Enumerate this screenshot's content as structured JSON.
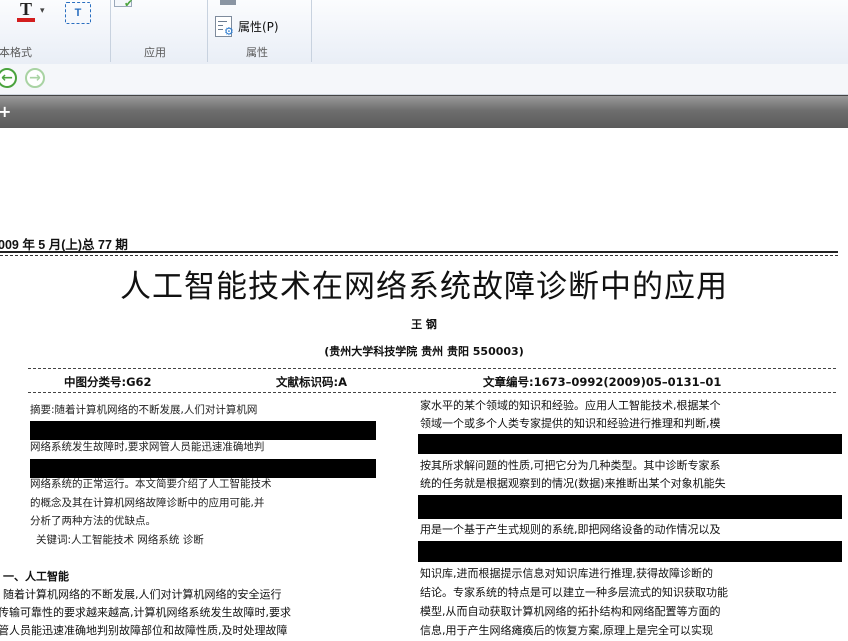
{
  "ribbon": {
    "groups": [
      "本格式",
      "应用",
      "属性"
    ],
    "properties_button": "属性(P)",
    "font_color_icon": "font-color-icon",
    "text_frame_icon": "text-frame-icon",
    "dropdown_arrow": "▾",
    "text_frame_glyph": "T"
  },
  "nav": {
    "back_glyph": "←",
    "forward_glyph": "→"
  },
  "toolbar": {
    "add_glyph": "+"
  },
  "doc": {
    "issue": "009 年 5 月(上)总 77 期",
    "title": "人工智能技术在网络系统故障诊断中的应用",
    "author": "王 钢",
    "affiliation": "(贵州大学科技学院   贵州 贵阳 550003)",
    "meta": {
      "class_no": "中图分类号:G62",
      "doc_code": "文献标识码:A",
      "article_no": "文章编号:1673–0992(2009)05–0131–01"
    },
    "abstract_lines": [
      "摘要:随着计算机网络的不断发展,人们对计算机网",
      "网络系统发生故障时,要求网管人员能迅速准确地判",
      "网络系统的正常运行。本文简要介绍了人工智能技术",
      "的概念及其在计算机网络故障诊断中的应用可能,并",
      "分析了两种方法的优缺点。"
    ],
    "keywords": "关键词:人工智能技术  网络系统  诊断",
    "section1_heading": "一、人工智能",
    "left_body": [
      "随着计算机网络的不断发展,人们对计算机网络的安全运行",
      "传输可靠性的要求越来越高,计算机网络系统发生故障时,要求",
      "管人员能迅速准确地判别故障部位和故障性质,及时处理故障"
    ],
    "right_lines": [
      "家水平的某个领域的知识和经验。应用人工智能技术,根据某个",
      "领域一个或多个人类专家提供的知识和经验进行推理和判断,模",
      "按其所求解问题的性质,可把它分为几种类型。其中诊断专家系",
      "统的任务就是根据观察到的情况(数据)来推断出某个对象机能失",
      "用是一个基于产生式规则的系统,即把网络设备的动作情况以及",
      "知识库,进而根据提示信息对知识库进行推理,获得故障诊断的",
      "结论。专家系统的特点是可以建立一种多层流式的知识获取功能",
      "模型,从而自动获取计算机网络的拓扑结构和网络配置等方面的",
      "信息,用于产生网络瘫痪后的恢复方案,原理上是完全可以实现"
    ]
  }
}
